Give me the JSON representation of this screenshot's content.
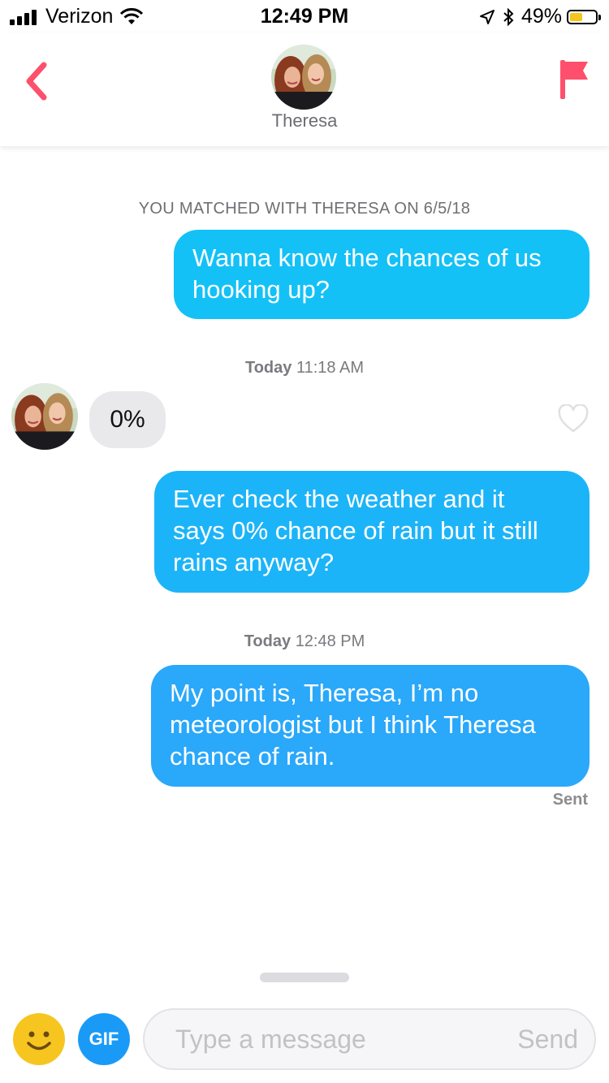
{
  "status_bar": {
    "carrier": "Verizon",
    "time": "12:49 PM",
    "battery_text": "49%",
    "battery_level": 0.49,
    "battery_color": "#f4c51d",
    "icons": [
      "signal-bars-icon",
      "wifi-icon",
      "location-arrow-icon",
      "bluetooth-icon",
      "battery-icon"
    ]
  },
  "header": {
    "contact_name": "Theresa",
    "back_icon": "chevron-left-icon",
    "report_icon": "flag-icon",
    "accent_color": "#fe4f6c"
  },
  "chat": {
    "match_note": "YOU MATCHED WITH THERESA ON 6/5/18",
    "messages": [
      {
        "direction": "outgoing",
        "lines": [
          "Wanna know the chances of us",
          "hooking up?"
        ]
      },
      {
        "timestamp_day": "Today",
        "timestamp_time": "11:18 AM"
      },
      {
        "direction": "incoming",
        "text": "0%"
      },
      {
        "direction": "outgoing",
        "lines": [
          "Ever check the weather and it",
          "says 0% chance of rain but it still",
          "rains anyway?"
        ]
      },
      {
        "timestamp_day": "Today",
        "timestamp_time": "12:48 PM"
      },
      {
        "direction": "outgoing",
        "lines": [
          "My point is, Theresa, I’m no",
          "meteorologist but I think Theresa",
          "chance of rain."
        ]
      }
    ],
    "delivery_status": "Sent"
  },
  "compose": {
    "gif_label": "GIF",
    "placeholder": "Type a message",
    "send_label": "Send"
  }
}
